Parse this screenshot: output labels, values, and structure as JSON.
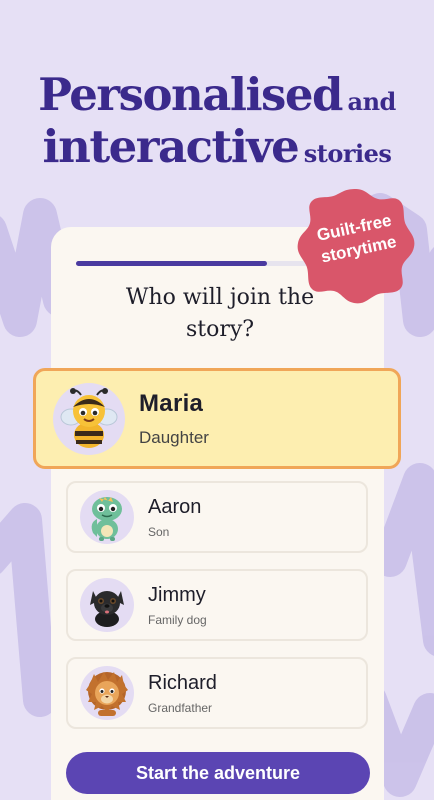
{
  "headline": {
    "line1_big": "Personalised",
    "line1_small": "and",
    "line2_big": "interactive",
    "line2_small": "stories"
  },
  "badge": {
    "line1": "Guilt-free",
    "line2": "storytime"
  },
  "onboarding": {
    "progress_fraction": 0.78,
    "question_line1": "Who will join the",
    "question_line2": "story?"
  },
  "people": [
    {
      "name": "Maria",
      "role": "Daughter",
      "avatar_icon": "bee-icon",
      "selected": true
    },
    {
      "name": "Aaron",
      "role": "Son",
      "avatar_icon": "dinosaur-icon",
      "selected": false
    },
    {
      "name": "Jimmy",
      "role": "Family dog",
      "avatar_icon": "dog-icon",
      "selected": false
    },
    {
      "name": "Richard",
      "role": "Grandfather",
      "avatar_icon": "lion-icon",
      "selected": false
    }
  ],
  "cta": {
    "label": "Start the adventure"
  },
  "colors": {
    "background": "#e6e0f5",
    "brand_purple": "#3b2a8c",
    "button": "#5b45b3",
    "badge_red": "#d9566a",
    "selected_fill": "#fdeeb0",
    "selected_border": "#f0a658"
  }
}
